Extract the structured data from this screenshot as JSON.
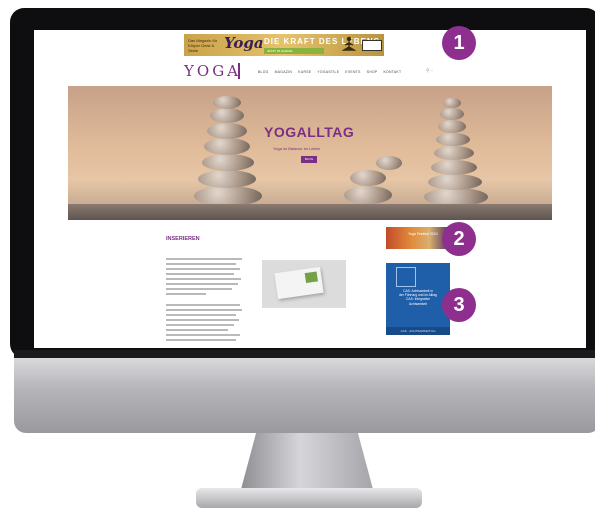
{
  "topbanner": {
    "small_text": "Das Magazin für Körper Geist & Seele",
    "logo_text": "Yoga",
    "headline": "DIE KRAFT DES LEBENS",
    "subline": "JETZT IM HANDEL"
  },
  "site": {
    "logo": "YOGA",
    "nav": [
      "BLOG",
      "MAGAZIN",
      "KURSE",
      "YOGASTILE",
      "EVENTS",
      "SHOP",
      "KONTAKT"
    ]
  },
  "hero": {
    "title": "YOGALLTAG",
    "subtitle": "Yoga ist Balance im Leben",
    "button": "BLOG"
  },
  "section": {
    "title": "INSERIEREN"
  },
  "ads": {
    "ad2_text": "Yoga Festival 2024",
    "ad3_lines": [
      "CAS: Achtsamkeit in",
      "der Führung und im Alltag",
      "CAS: Integrative",
      "Achtsamkeit"
    ],
    "ad3_footer": "CAS · ACHTSAMKEIT.CH"
  },
  "callouts": [
    "1",
    "2",
    "3"
  ]
}
